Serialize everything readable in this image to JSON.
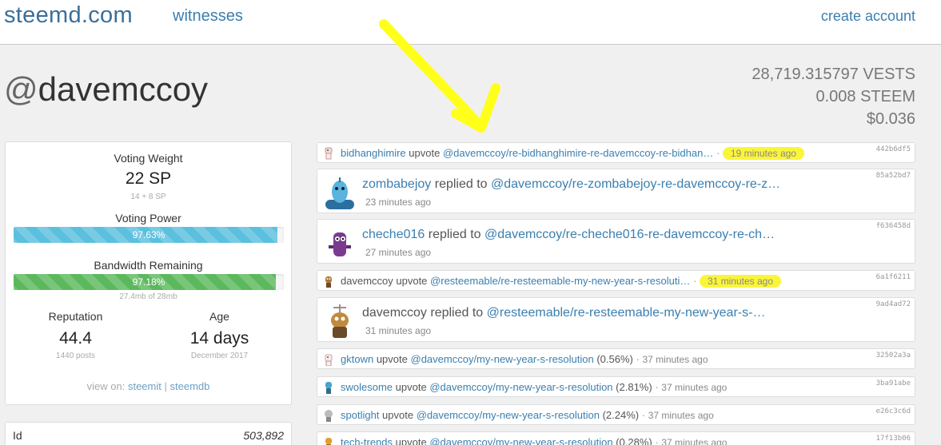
{
  "nav": {
    "brand": "steemd.com",
    "witnesses": "witnesses",
    "create_account": "create account"
  },
  "account": {
    "at": "@",
    "name": "davemccoy",
    "vests": "28,719.315797 VESTS",
    "steem": "0.008 STEEM",
    "usd": "$0.036"
  },
  "stats": {
    "voting_weight_label": "Voting Weight",
    "voting_weight_value": "22 SP",
    "voting_weight_sub": "14 + 8 SP",
    "voting_power_label": "Voting Power",
    "voting_power_text": "97.63%",
    "voting_power_percent": 97.63,
    "bandwidth_label": "Bandwidth Remaining",
    "bandwidth_text": "97.18%",
    "bandwidth_percent": 97.18,
    "bandwidth_sub": "27.4mb of 28mb",
    "reputation_label": "Reputation",
    "reputation_value": "44.4",
    "reputation_sub": "1440 posts",
    "age_label": "Age",
    "age_value": "14 days",
    "age_sub": "December 2017",
    "view_on": "view on:",
    "steemit": "steemit",
    "sep": "|",
    "steemdb": "steemdb",
    "id_label": "Id",
    "id_value": "503,892",
    "bar_colors": {
      "voting_power": "#5bc0de",
      "bandwidth": "#5cb85c"
    }
  },
  "feed": [
    {
      "type": "vote",
      "user": "bidhanghimire",
      "action": "upvote",
      "target": "@davemccoy/re-bidhanghimire-re-davemccoy-re-bidhan…",
      "time": "19 minutes ago",
      "highlight": true,
      "hash": "442b6df5",
      "avatar_icon": "robot-avatar-icon"
    },
    {
      "type": "reply",
      "user": "zombabejoy",
      "action": "replied to",
      "target": "@davemccoy/re-zombabejoy-re-davemccoy-re-z…",
      "time": "23 minutes ago",
      "hash": "85a52bd7",
      "avatar_icon": "robot-avatar-icon"
    },
    {
      "type": "reply",
      "user": "cheche016",
      "action": "replied to",
      "target": "@davemccoy/re-cheche016-re-davemccoy-re-ch…",
      "time": "27 minutes ago",
      "hash": "f636458d",
      "avatar_icon": "robot-avatar-icon"
    },
    {
      "type": "vote",
      "user": "davemccoy",
      "action": "upvote",
      "target": "@resteemable/re-resteemable-my-new-year-s-resoluti…",
      "time": "31 minutes ago",
      "highlight": true,
      "hash": "6a1f6211",
      "avatar_icon": "robot-avatar-icon"
    },
    {
      "type": "reply",
      "user": "davemccoy",
      "action": "replied to",
      "target": "@resteemable/re-resteemable-my-new-year-s-…",
      "time": "31 minutes ago",
      "hash": "9ad4ad72",
      "avatar_icon": "robot-avatar-icon"
    },
    {
      "type": "vote",
      "user": "gktown",
      "action": "upvote",
      "target": "@davemccoy/my-new-year-s-resolution",
      "pct": "(0.56%)",
      "time": "37 minutes ago",
      "hash": "32502a3a",
      "avatar_icon": "robot-avatar-icon"
    },
    {
      "type": "vote",
      "user": "swolesome",
      "action": "upvote",
      "target": "@davemccoy/my-new-year-s-resolution",
      "pct": "(2.81%)",
      "time": "37 minutes ago",
      "hash": "3ba91abe",
      "avatar_icon": "robot-avatar-icon"
    },
    {
      "type": "vote",
      "user": "spotlight",
      "action": "upvote",
      "target": "@davemccoy/my-new-year-s-resolution",
      "pct": "(2.24%)",
      "time": "37 minutes ago",
      "hash": "e26c3c6d",
      "avatar_icon": "robot-avatar-icon"
    },
    {
      "type": "vote",
      "user": "tech-trends",
      "action": "upvote",
      "target": "@davemccoy/my-new-year-s-resolution",
      "pct": "(0.28%)",
      "time": "37 minutes ago",
      "hash": "17f13b06",
      "avatar_icon": "robot-avatar-icon"
    }
  ],
  "annotation": {
    "arrow_color": "#ffff1a",
    "highlight_color": "#fbf53a"
  }
}
